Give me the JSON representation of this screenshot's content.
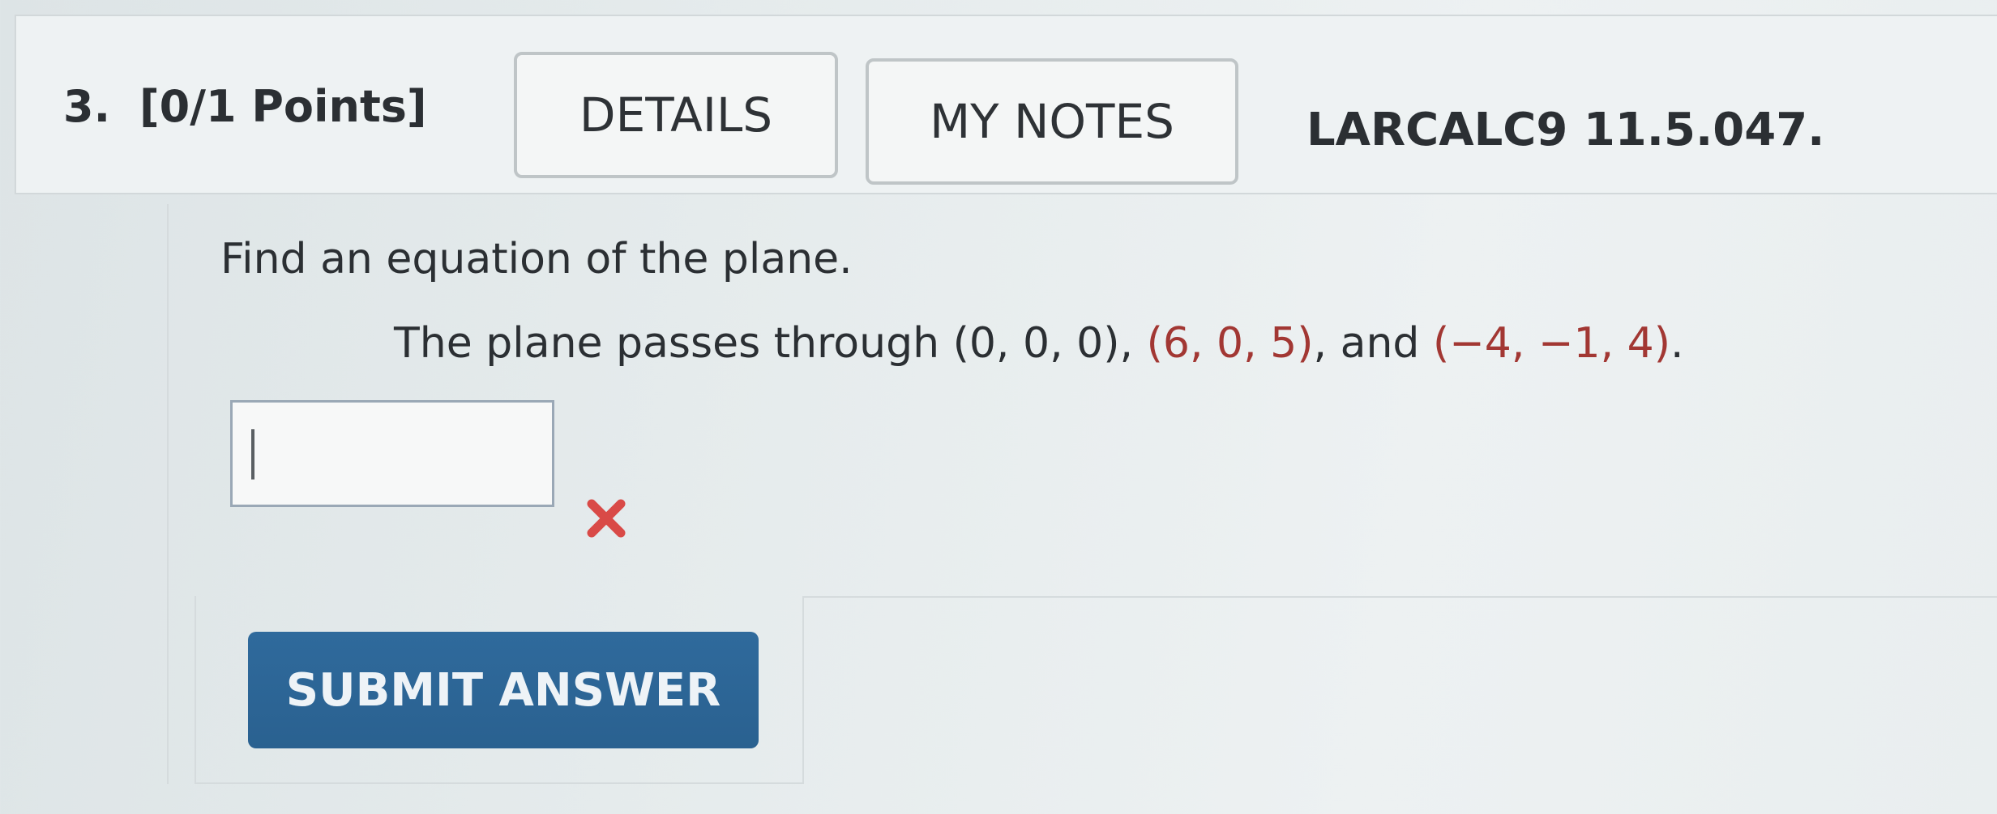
{
  "question": {
    "number": "3.",
    "points": "[0/1 Points]",
    "details_label": "DETAILS",
    "my_notes_label": "MY NOTES",
    "code": "LARCALC9 11.5.047."
  },
  "problem": {
    "prompt": "Find an equation of the plane.",
    "sentence_prefix": "The plane passes through ",
    "point1": "(0, 0, 0)",
    "sep1": ", ",
    "point2": "(6, 0, 5)",
    "sep2": ", and ",
    "point3": "(−4, −1, 4)",
    "sentence_end": "."
  },
  "answer": {
    "value": "",
    "status_icon": "incorrect-x-icon"
  },
  "submit_label": "SUBMIT ANSWER",
  "colors": {
    "highlight": "#a23733",
    "submit_bg": "#2f6a9c",
    "incorrect": "#d94a47"
  }
}
